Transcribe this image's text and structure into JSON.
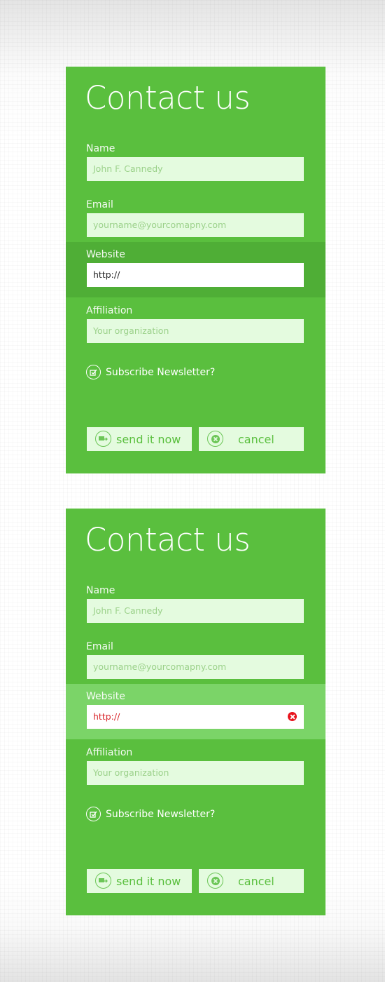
{
  "colors": {
    "card_bg": "#5abf3e",
    "input_bg": "#e4fbdf",
    "placeholder_text": "#9bd18a",
    "focus_row_dark": "#4fae36",
    "error_row_light": "#7bd468",
    "error_text": "#d8242a",
    "error_icon": "#e8141e"
  },
  "forms": [
    {
      "state": "focused",
      "title": "Contact us",
      "fields": [
        {
          "label": "Name",
          "placeholder": "John F. Cannedy",
          "value": ""
        },
        {
          "label": "Email",
          "placeholder": "yourname@yourcomapny.com",
          "value": ""
        },
        {
          "label": "Website",
          "placeholder": "",
          "value": "http://"
        },
        {
          "label": "Affiliation",
          "placeholder": "Your organization",
          "value": ""
        }
      ],
      "subscribe_label": "Subscribe Newsletter?",
      "send_label": "send it now",
      "cancel_label": "cancel"
    },
    {
      "state": "error",
      "title": "Contact us",
      "fields": [
        {
          "label": "Name",
          "placeholder": "John F. Cannedy",
          "value": ""
        },
        {
          "label": "Email",
          "placeholder": "yourname@yourcomapny.com",
          "value": ""
        },
        {
          "label": "Website",
          "placeholder": "",
          "value": "http://",
          "error_icon": "error-x-icon"
        },
        {
          "label": "Affiliation",
          "placeholder": "Your organization",
          "value": ""
        }
      ],
      "subscribe_label": "Subscribe Newsletter?",
      "send_label": "send it now",
      "cancel_label": "cancel"
    }
  ]
}
